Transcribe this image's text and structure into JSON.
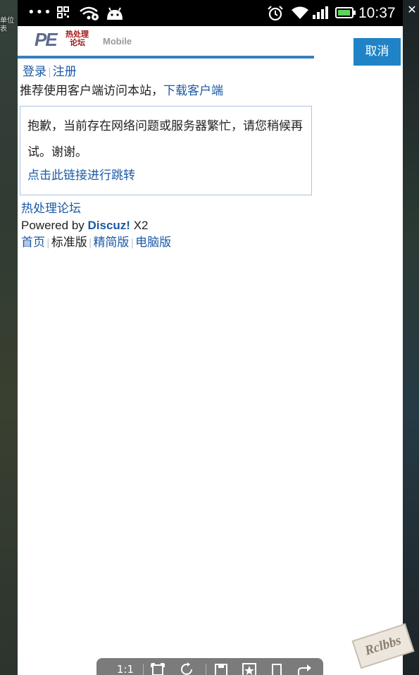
{
  "desktop": {
    "left_label_lines": [
      "单位",
      "表"
    ],
    "close_symbol": "✕"
  },
  "status_bar": {
    "time": "10:37",
    "left_icons": [
      "more-dots-icon",
      "qr-grid-icon",
      "wifi-share-icon",
      "android-icon"
    ],
    "right_icons": [
      "alarm-clock-icon",
      "wifi-icon",
      "signal-icon",
      "battery-icon"
    ]
  },
  "header": {
    "logo_text": "PE",
    "logo_chinese_line1": "热处理",
    "logo_chinese_line2": "论坛",
    "logo_suffix": "Mobile",
    "cancel_label": "取消",
    "accent_color": "#3a7fc1"
  },
  "auth": {
    "login_label": "登录",
    "register_label": "注册",
    "separator": "|"
  },
  "recommend": {
    "text": "推荐使用客户端访问本站，",
    "download_label": "下载客户端"
  },
  "message": {
    "text": "抱歉，当前存在网络问题或服务器繁忙，请您稍候再试。谢谢。",
    "link_label": "点击此链接进行跳转"
  },
  "footer": {
    "forum_name": "热处理论坛",
    "powered_prefix": "Powered by ",
    "powered_brand": "Discuz!",
    "powered_version": " X2",
    "nav": [
      {
        "label": "首页",
        "link": true
      },
      {
        "label": "标准版",
        "link": false
      },
      {
        "label": "精简版",
        "link": true
      },
      {
        "label": "电脑版",
        "link": true
      }
    ],
    "separator": "|"
  },
  "watermark": {
    "text": "Rclbbs"
  },
  "toolbar": {
    "ratio_label": "1:1"
  }
}
